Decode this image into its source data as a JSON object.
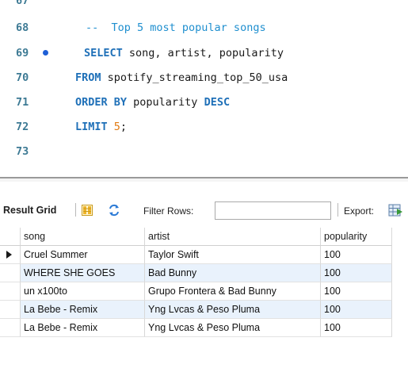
{
  "editor": {
    "lines": [
      {
        "num": "67",
        "parts": []
      },
      {
        "num": "68",
        "parts": [
          {
            "type": "comment",
            "text": "--  Top 5 most popular songs"
          }
        ]
      },
      {
        "num": "69",
        "parts": [
          {
            "type": "kw",
            "text": "SELECT"
          },
          {
            "type": "plain",
            "text": " song, artist, popularity"
          }
        ]
      },
      {
        "num": "70",
        "parts": [
          {
            "type": "kw",
            "text": "FROM"
          },
          {
            "type": "plain",
            "text": " spotify_streaming_top_50_usa"
          }
        ]
      },
      {
        "num": "71",
        "parts": [
          {
            "type": "kw",
            "text": "ORDER BY"
          },
          {
            "type": "plain",
            "text": " popularity "
          },
          {
            "type": "kw",
            "text": "DESC"
          }
        ]
      },
      {
        "num": "72",
        "parts": [
          {
            "type": "kw",
            "text": "LIMIT"
          },
          {
            "type": "num",
            "text": " 5"
          },
          {
            "type": "plain",
            "text": ";"
          }
        ]
      },
      {
        "num": "73",
        "parts": []
      }
    ],
    "active_line": "69"
  },
  "toolbar": {
    "result_grid_label": "Result Grid",
    "filter_label": "Filter Rows:",
    "filter_value": "",
    "export_label": "Export:"
  },
  "grid": {
    "columns": [
      "song",
      "artist",
      "popularity"
    ],
    "rows": [
      {
        "song": "Cruel Summer",
        "artist": "Taylor Swift",
        "popularity": "100"
      },
      {
        "song": "WHERE SHE GOES",
        "artist": "Bad Bunny",
        "popularity": "100"
      },
      {
        "song": "un x100to",
        "artist": "Grupo Frontera & Bad Bunny",
        "popularity": "100"
      },
      {
        "song": "La Bebe - Remix",
        "artist": "Yng Lvcas & Peso Pluma",
        "popularity": "100"
      },
      {
        "song": "La Bebe - Remix",
        "artist": "Yng Lvcas & Peso Pluma",
        "popularity": "100"
      }
    ],
    "selected_row": 0
  },
  "colors": {
    "line_number": "#3d7a94",
    "keyword": "#1f70b8",
    "comment": "#1f8fcf",
    "number": "#e27a12",
    "row_alternate": "#e9f2fc",
    "active_line_dot": "#1e5fd6"
  },
  "icons": {
    "grid_view": "grid-view-icon",
    "refresh": "refresh-icon",
    "export": "export-icon",
    "row_pointer": "row-pointer-icon"
  }
}
